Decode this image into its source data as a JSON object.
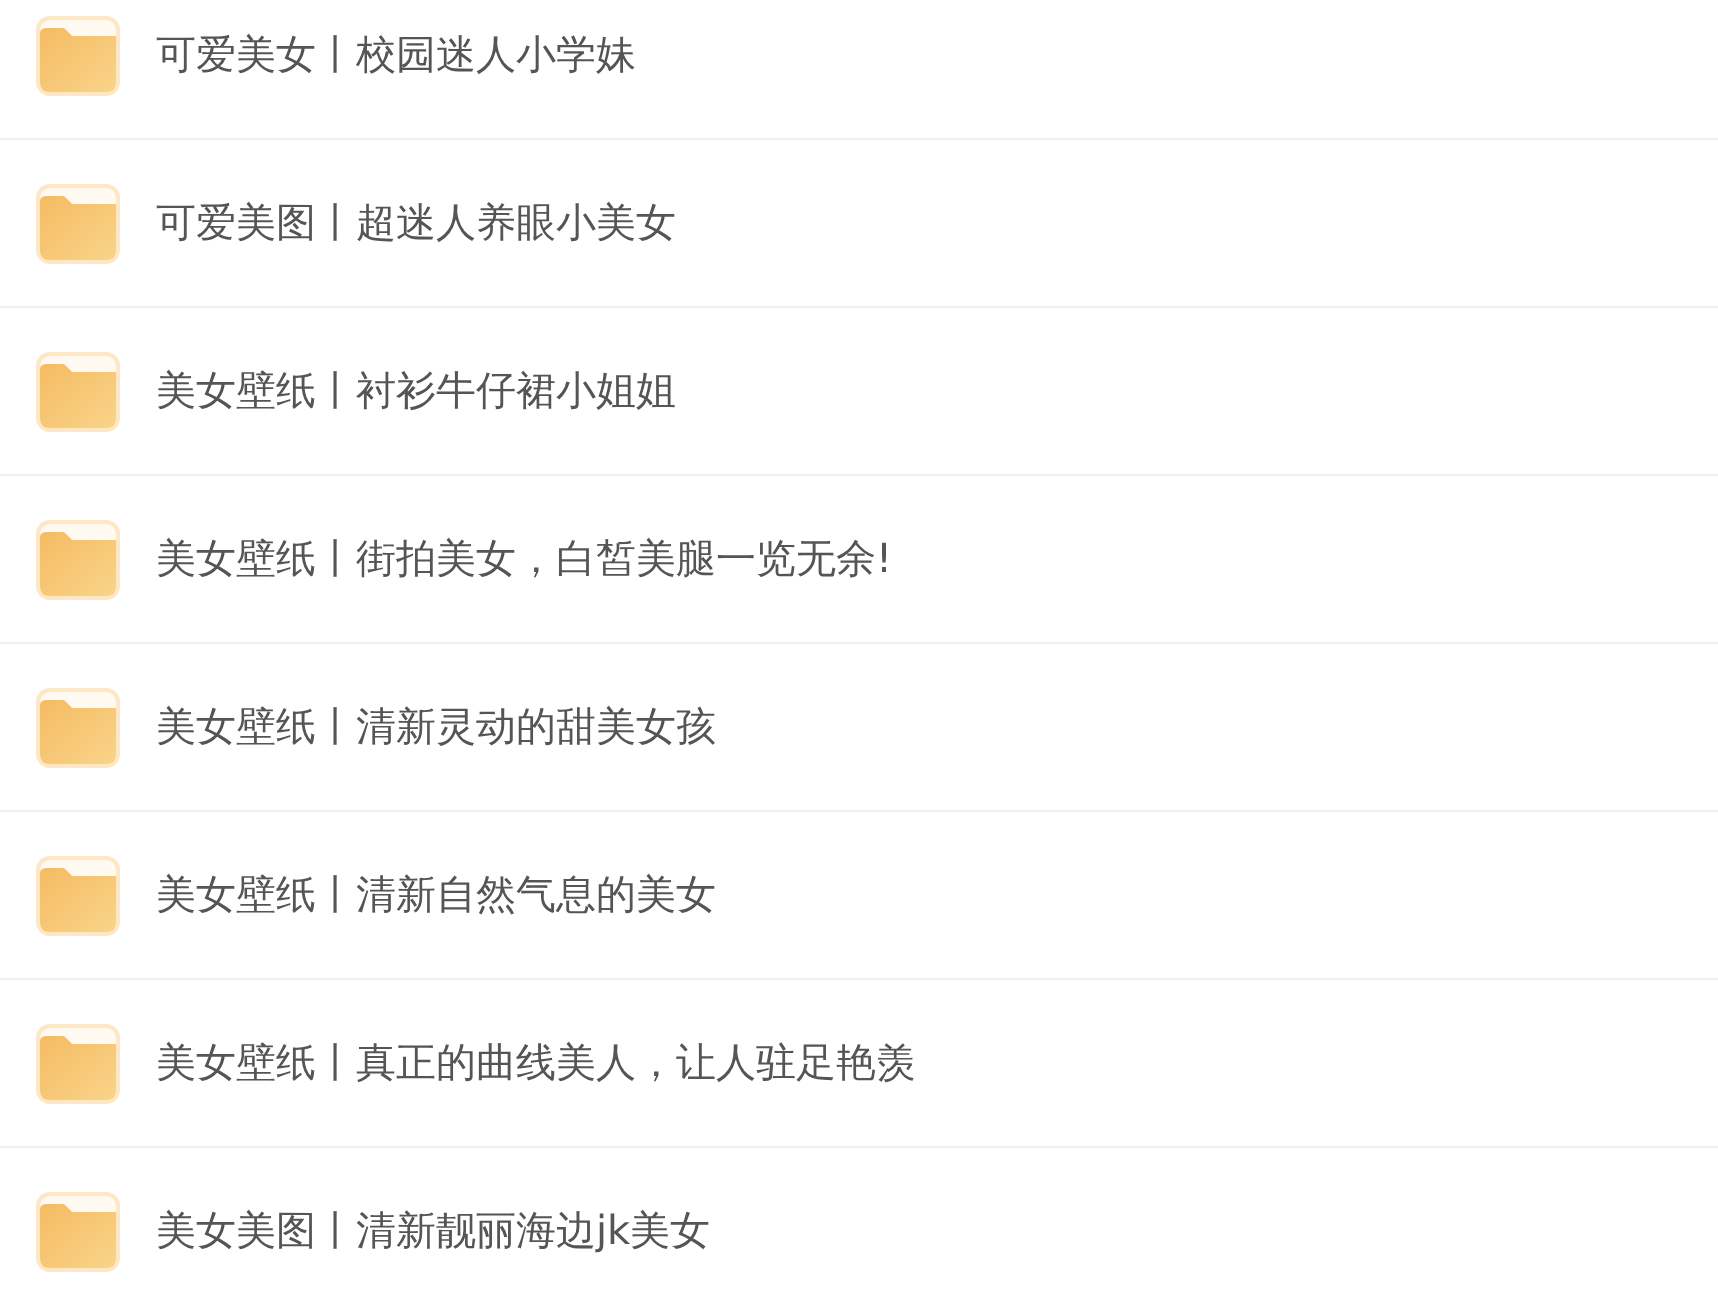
{
  "folders": [
    {
      "name": "可爱美女丨校园迷人小学妹"
    },
    {
      "name": "可爱美图丨超迷人养眼小美女"
    },
    {
      "name": "美女壁纸丨衬衫牛仔裙小姐姐"
    },
    {
      "name": "美女壁纸丨街拍美女，白皙美腿一览无余!"
    },
    {
      "name": "美女壁纸丨清新灵动的甜美女孩"
    },
    {
      "name": "美女壁纸丨清新自然气息的美女"
    },
    {
      "name": "美女壁纸丨真正的曲线美人，让人驻足艳羡"
    },
    {
      "name": "美女美图丨清新靓丽海边jk美女"
    }
  ]
}
